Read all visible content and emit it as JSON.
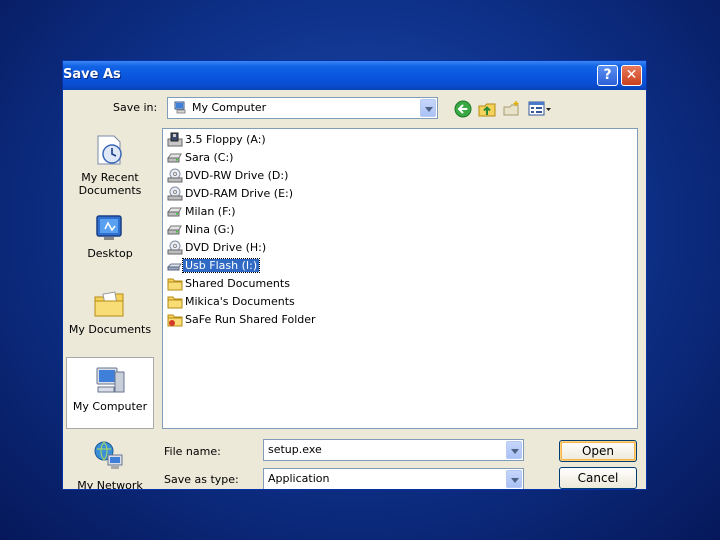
{
  "window": {
    "title": "Save As",
    "help_symbol": "?",
    "close_symbol": "✕"
  },
  "toolbar": {
    "save_in_label": "Save in:",
    "save_in_value": "My Computer",
    "icons": [
      "back-icon",
      "up-folder-icon",
      "new-folder-icon",
      "views-menu-icon"
    ]
  },
  "places": [
    {
      "label": "My Recent Documents",
      "icon": "recent-documents-icon"
    },
    {
      "label": "Desktop",
      "icon": "desktop-icon"
    },
    {
      "label": "My Documents",
      "icon": "my-documents-icon"
    },
    {
      "label": "My Computer",
      "icon": "my-computer-icon",
      "selected": true
    },
    {
      "label": "My Network",
      "icon": "my-network-icon"
    }
  ],
  "files": [
    {
      "name": "3.5 Floppy (A:)",
      "icon": "floppy-drive-icon"
    },
    {
      "name": "Sara (C:)",
      "icon": "hard-drive-icon"
    },
    {
      "name": "DVD-RW Drive (D:)",
      "icon": "optical-drive-icon"
    },
    {
      "name": "DVD-RAM Drive (E:)",
      "icon": "optical-drive-icon"
    },
    {
      "name": "Milan (F:)",
      "icon": "hard-drive-icon"
    },
    {
      "name": "Nina (G:)",
      "icon": "hard-drive-icon"
    },
    {
      "name": "DVD Drive (H:)",
      "icon": "optical-drive-icon"
    },
    {
      "name": "Usb Flash (I:)",
      "icon": "removable-drive-icon",
      "selected": true
    },
    {
      "name": "Shared Documents",
      "icon": "folder-icon"
    },
    {
      "name": "Mikica's Documents",
      "icon": "folder-icon"
    },
    {
      "name": "SaFe Run Shared Folder",
      "icon": "shared-folder-icon"
    }
  ],
  "form": {
    "file_name_label": "File name:",
    "file_name_value": "setup.exe",
    "save_as_type_label": "Save as type:",
    "save_as_type_value": "Application",
    "open_button": "Open",
    "cancel_button": "Cancel"
  },
  "colors": {
    "titlebar": "#0a55de",
    "selection": "#316ac5",
    "dialog_face": "#ece9d8",
    "desktop": "#0d2f86"
  }
}
